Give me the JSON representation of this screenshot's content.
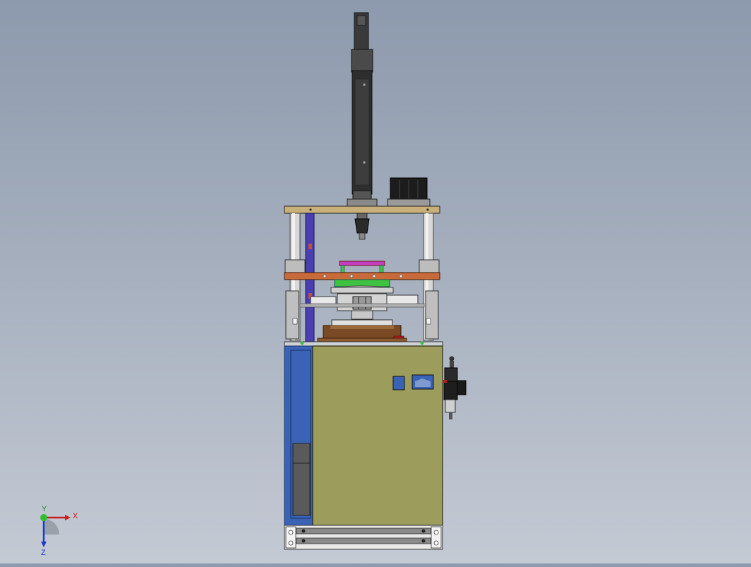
{
  "triad": {
    "x_label": "X",
    "y_label": "Y",
    "z_label": "Z"
  },
  "colors": {
    "background_top": "#8d9aad",
    "background_bottom": "#c4cad4",
    "cabinet_panel": "#9c9c5c",
    "side_panel": "#3a63b6",
    "top_plate": "#c9b07a",
    "mid_plate": "#c86a3a",
    "fixture_green": "#3fc23f",
    "fixture_magenta": "#c23fbf",
    "base_block": "#7a4a24",
    "motor_black": "#2a2a2a",
    "guide_column": "#d8d8d8"
  }
}
